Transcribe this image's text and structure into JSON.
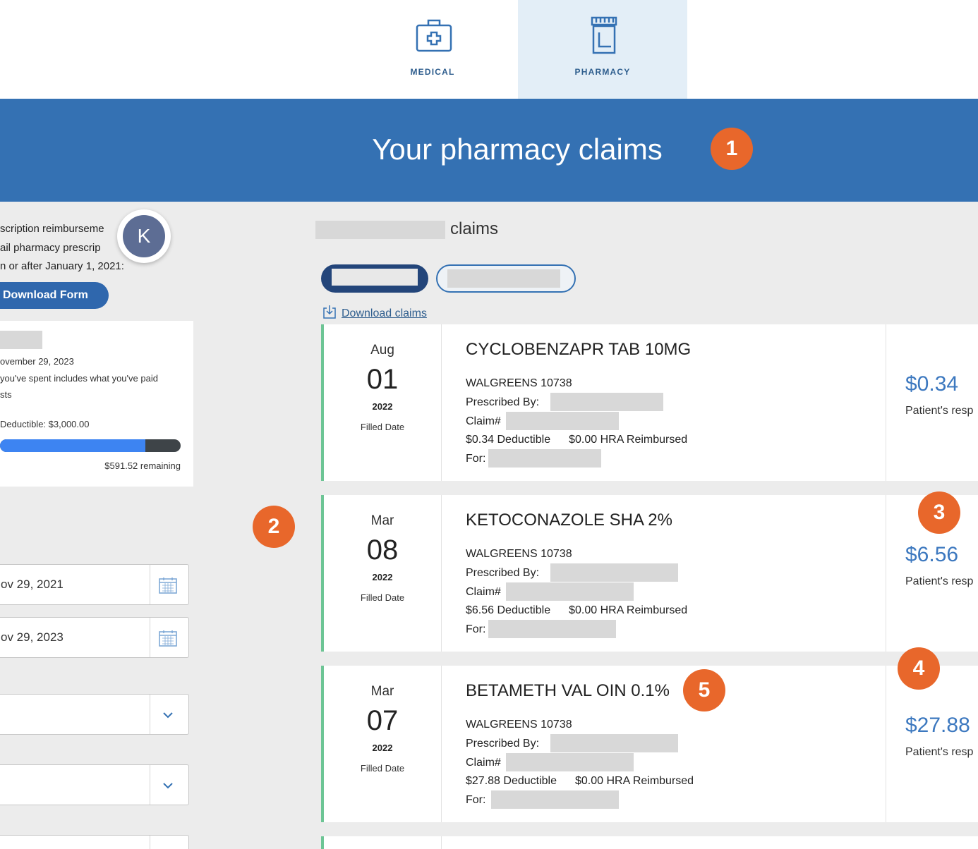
{
  "tabs": [
    {
      "label": "MEDICAL",
      "icon": "medical-kit-icon",
      "active": false
    },
    {
      "label": "PHARMACY",
      "icon": "pill-bottle-icon",
      "active": true
    }
  ],
  "banner": {
    "title": "Your pharmacy claims"
  },
  "annotations": [
    "1",
    "2",
    "3",
    "4",
    "5"
  ],
  "left": {
    "line1": "scription reimburseme",
    "line2": "ail pharmacy prescrip",
    "line3": "n or after January 1, 2021:",
    "avatar_letter": "K",
    "download_form": "Download Form",
    "deductible": {
      "date": "ovember 29, 2023",
      "note1": "you've spent includes what you've paid",
      "note2": "sts",
      "label": "Deductible: $3,000.00",
      "progress_fraction": 0.8028,
      "remaining": "$591.52 remaining"
    },
    "date_from": "ov 29, 2021",
    "date_to": "ov 29, 2023"
  },
  "main": {
    "heading": "claims",
    "download_claims": "Download claims",
    "filled_label": "Filled Date",
    "prescribed_label": "Prescribed By:",
    "claim_label": "Claim#",
    "for_label": "For:",
    "resp_label": "Patient's resp",
    "claims": [
      {
        "month": "Aug",
        "day": "01",
        "year": "2022",
        "drug": "CYCLOBENZAPR TAB 10MG",
        "pharmacy": "WALGREENS 10738",
        "deductible": "$0.34 Deductible",
        "hra": "$0.00 HRA Reimbursed",
        "amount": "$0.34"
      },
      {
        "month": "Mar",
        "day": "08",
        "year": "2022",
        "drug": "KETOCONAZOLE SHA 2%",
        "pharmacy": "WALGREENS 10738",
        "deductible": "$6.56 Deductible",
        "hra": "$0.00 HRA Reimbursed",
        "amount": "$6.56"
      },
      {
        "month": "Mar",
        "day": "07",
        "year": "2022",
        "drug": "BETAMETH VAL OIN 0.1%",
        "pharmacy": "WALGREENS 10738",
        "deductible": "$27.88 Deductible",
        "hra": "$0.00 HRA Reimbursed",
        "amount": "$27.88"
      }
    ]
  },
  "colors": {
    "banner": "#3471b3",
    "badge": "#e8672b",
    "accent_green": "#6dc595",
    "amount_blue": "#3c78bf"
  }
}
